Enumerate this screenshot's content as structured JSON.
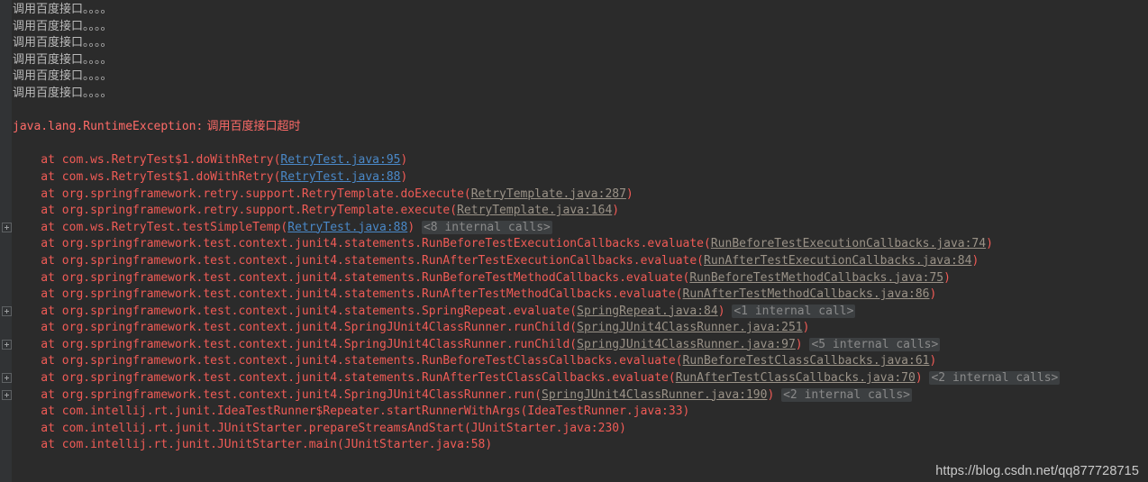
{
  "console": {
    "background_color": "#2b2b2b",
    "gutter_color": "#313335",
    "colors": {
      "stdout": "#bbbbbb",
      "exception_header": "#ff6b68",
      "stacktrace": "#f05b56",
      "link_project": "#4a88c7",
      "link_library": "#9a9287",
      "folded_badge_text": "#8a8a8a",
      "folded_badge_bg": "#3c3f41"
    },
    "stdout_lines": [
      "调用百度接口。。。。",
      "调用百度接口。。。。",
      "调用百度接口。。。。",
      "调用百度接口。。。。",
      "调用百度接口。。。。",
      "调用百度接口。。。。"
    ],
    "exception": {
      "type": "java.lang.RuntimeException:",
      "message": " 调用百度接口超时"
    },
    "stack_frames": [
      {
        "expander": false,
        "prefix": "    at com.ws.RetryTest$1.doWithRetry(",
        "link": "RetryTest.java:95",
        "link_kind": "project",
        "suffix": ")",
        "folded": ""
      },
      {
        "expander": false,
        "prefix": "    at com.ws.RetryTest$1.doWithRetry(",
        "link": "RetryTest.java:88",
        "link_kind": "project",
        "suffix": ")",
        "folded": ""
      },
      {
        "expander": false,
        "prefix": "    at org.springframework.retry.support.RetryTemplate.doExecute(",
        "link": "RetryTemplate.java:287",
        "link_kind": "library",
        "suffix": ")",
        "folded": ""
      },
      {
        "expander": false,
        "prefix": "    at org.springframework.retry.support.RetryTemplate.execute(",
        "link": "RetryTemplate.java:164",
        "link_kind": "library",
        "suffix": ")",
        "folded": ""
      },
      {
        "expander": true,
        "prefix": "    at com.ws.RetryTest.testSimpleTemp(",
        "link": "RetryTest.java:88",
        "link_kind": "project",
        "suffix": ")",
        "folded": "<8 internal calls>"
      },
      {
        "expander": false,
        "prefix": "    at org.springframework.test.context.junit4.statements.RunBeforeTestExecutionCallbacks.evaluate(",
        "link": "RunBeforeTestExecutionCallbacks.java:74",
        "link_kind": "library",
        "suffix": ")",
        "folded": ""
      },
      {
        "expander": false,
        "prefix": "    at org.springframework.test.context.junit4.statements.RunAfterTestExecutionCallbacks.evaluate(",
        "link": "RunAfterTestExecutionCallbacks.java:84",
        "link_kind": "library",
        "suffix": ")",
        "folded": ""
      },
      {
        "expander": false,
        "prefix": "    at org.springframework.test.context.junit4.statements.RunBeforeTestMethodCallbacks.evaluate(",
        "link": "RunBeforeTestMethodCallbacks.java:75",
        "link_kind": "library",
        "suffix": ")",
        "folded": ""
      },
      {
        "expander": false,
        "prefix": "    at org.springframework.test.context.junit4.statements.RunAfterTestMethodCallbacks.evaluate(",
        "link": "RunAfterTestMethodCallbacks.java:86",
        "link_kind": "library",
        "suffix": ")",
        "folded": ""
      },
      {
        "expander": true,
        "prefix": "    at org.springframework.test.context.junit4.statements.SpringRepeat.evaluate(",
        "link": "SpringRepeat.java:84",
        "link_kind": "library",
        "suffix": ")",
        "folded": "<1 internal call>"
      },
      {
        "expander": false,
        "prefix": "    at org.springframework.test.context.junit4.SpringJUnit4ClassRunner.runChild(",
        "link": "SpringJUnit4ClassRunner.java:251",
        "link_kind": "library",
        "suffix": ")",
        "folded": ""
      },
      {
        "expander": true,
        "prefix": "    at org.springframework.test.context.junit4.SpringJUnit4ClassRunner.runChild(",
        "link": "SpringJUnit4ClassRunner.java:97",
        "link_kind": "library",
        "suffix": ")",
        "folded": "<5 internal calls>"
      },
      {
        "expander": false,
        "prefix": "    at org.springframework.test.context.junit4.statements.RunBeforeTestClassCallbacks.evaluate(",
        "link": "RunBeforeTestClassCallbacks.java:61",
        "link_kind": "library",
        "suffix": ")",
        "folded": ""
      },
      {
        "expander": true,
        "prefix": "    at org.springframework.test.context.junit4.statements.RunAfterTestClassCallbacks.evaluate(",
        "link": "RunAfterTestClassCallbacks.java:70",
        "link_kind": "library",
        "suffix": ")",
        "folded": "<2 internal calls>"
      },
      {
        "expander": true,
        "prefix": "    at org.springframework.test.context.junit4.SpringJUnit4ClassRunner.run(",
        "link": "SpringJUnit4ClassRunner.java:190",
        "link_kind": "library",
        "suffix": ")",
        "folded": "<2 internal calls>"
      },
      {
        "expander": false,
        "prefix": "    at com.intellij.rt.junit.IdeaTestRunner$Repeater.startRunnerWithArgs(IdeaTestRunner.java:33)",
        "link": "",
        "link_kind": "none",
        "suffix": "",
        "folded": ""
      },
      {
        "expander": false,
        "prefix": "    at com.intellij.rt.junit.JUnitStarter.prepareStreamsAndStart(JUnitStarter.java:230)",
        "link": "",
        "link_kind": "none",
        "suffix": "",
        "folded": ""
      },
      {
        "expander": false,
        "prefix": "    at com.intellij.rt.junit.JUnitStarter.main(JUnitStarter.java:58)",
        "link": "",
        "link_kind": "none",
        "suffix": "",
        "folded": ""
      }
    ]
  },
  "watermark": {
    "text": "https://blog.csdn.net/qq877728715"
  }
}
